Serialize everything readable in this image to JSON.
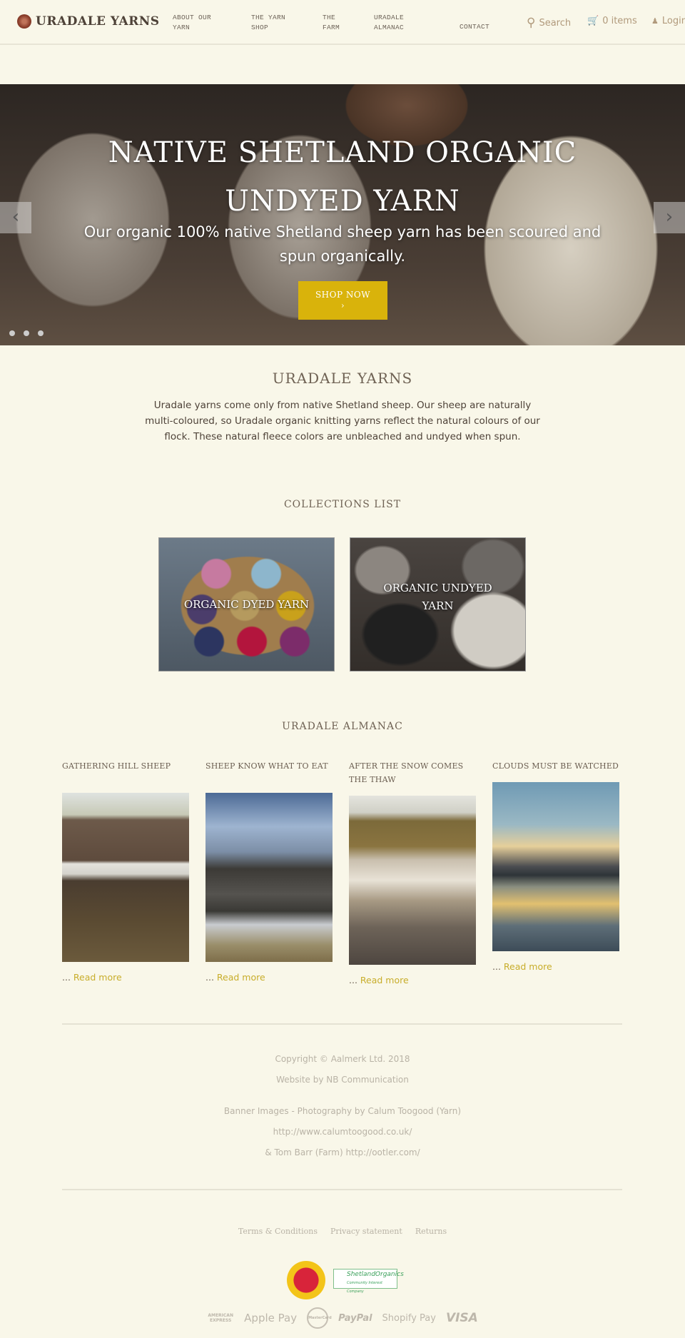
{
  "header": {
    "logo": "URADALE YARNS",
    "nav": [
      {
        "label": "ABOUT OUR YARN"
      },
      {
        "label": "THE YARN SHOP"
      },
      {
        "label": "THE FARM"
      },
      {
        "label": "URADALE ALMANAC"
      },
      {
        "label": "CONTACT"
      }
    ],
    "search": "Search",
    "cart": "0 items",
    "login": "Login"
  },
  "hero": {
    "title": "NATIVE SHETLAND ORGANIC UNDYED YARN",
    "subtitle": "Our organic 100% native Shetland sheep yarn has been scoured and spun organically.",
    "button": "SHOP NOW",
    "button_arrow": "›",
    "prev": "‹",
    "next": "›",
    "slides": 3,
    "active_slide": 1
  },
  "intro": {
    "title": "URADALE YARNS",
    "text": "Uradale yarns come only from native Shetland sheep. Our sheep are naturally multi-coloured, so Uradale organic knitting yarns reflect the natural colours of our flock. These natural fleece colors are unbleached and undyed when spun."
  },
  "collections": {
    "title": "COLLECTIONS LIST",
    "items": [
      {
        "label": "ORGANIC DYED YARN"
      },
      {
        "label": "ORGANIC UNDYED YARN"
      }
    ]
  },
  "almanac": {
    "title": "URADALE ALMANAC",
    "prefix": "...",
    "read_more": "Read more",
    "items": [
      {
        "title": "GATHERING HILL SHEEP"
      },
      {
        "title": "SHEEP KNOW WHAT TO EAT"
      },
      {
        "title": "AFTER THE SNOW COMES THE THAW"
      },
      {
        "title": "CLOUDS MUST BE WATCHED"
      }
    ]
  },
  "footer": {
    "copyright": "Copyright © Aalmerk Ltd. 2018",
    "website": "Website by NB Communication",
    "credit1": "Banner Images - Photography by Calum Toogood (Yarn)",
    "credit2": "http://www.calumtoogood.co.uk/",
    "credit3": "& Tom Barr (Farm) http://ootler.com/",
    "links": [
      "Terms & Conditions",
      "Privacy statement",
      "Returns"
    ],
    "badge2": "ShetlandOrganics",
    "badge2_sub": "Community Interest Company",
    "payments": [
      "AMERICAN EXPRESS",
      "Apple Pay",
      "MasterCard",
      "PayPal",
      "Shopify Pay",
      "VISA"
    ]
  },
  "colors": {
    "accent": "#d9b30b",
    "link": "#c8ad2a",
    "background": "#f9f7e9"
  }
}
